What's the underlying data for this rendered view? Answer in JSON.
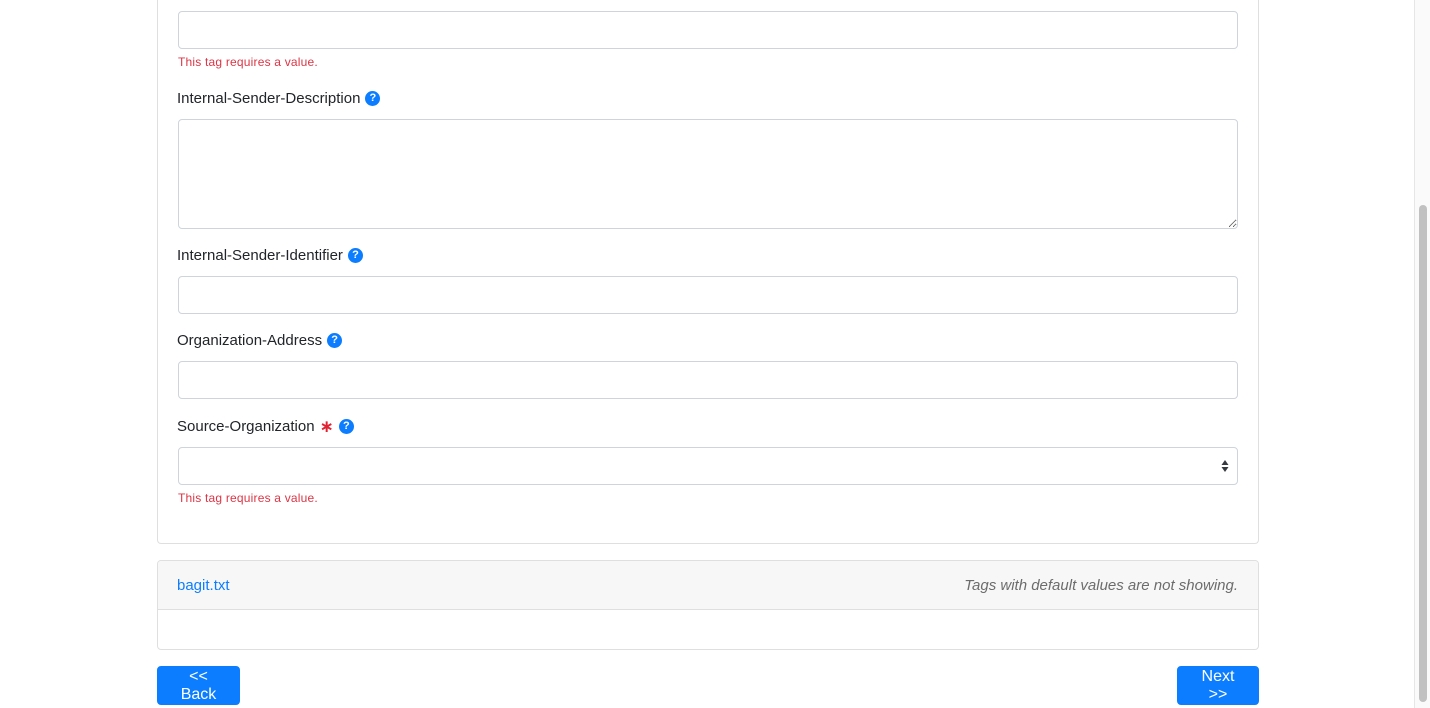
{
  "fields": {
    "top_input": {
      "value": "",
      "error": "This tag requires a value."
    },
    "internal_sender_description": {
      "label": "Internal-Sender-Description",
      "value": ""
    },
    "internal_sender_identifier": {
      "label": "Internal-Sender-Identifier",
      "value": ""
    },
    "organization_address": {
      "label": "Organization-Address",
      "value": ""
    },
    "source_organization": {
      "label": "Source-Organization",
      "required_mark": "∗",
      "value": "",
      "error": "This tag requires a value."
    }
  },
  "help_icon_glyph": "?",
  "bagit": {
    "link": "bagit.txt",
    "note": "Tags with default values are not showing."
  },
  "buttons": {
    "back": "<< Back",
    "next": "Next >>"
  },
  "colors": {
    "accent": "#0d7dff",
    "error": "#dc3545"
  }
}
